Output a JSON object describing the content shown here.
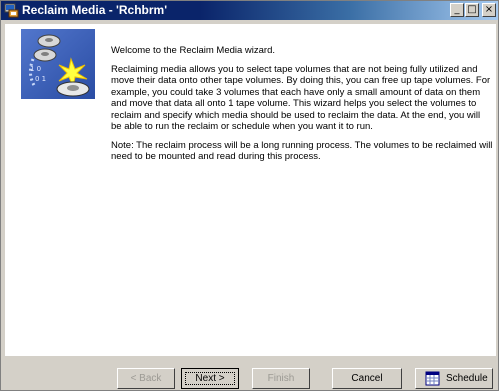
{
  "window": {
    "title": "Reclaim Media - 'Rchbrm'"
  },
  "title_buttons": {
    "minimize": "_",
    "maximize": "□",
    "close": "×"
  },
  "content": {
    "welcome": "Welcome to the Reclaim Media wizard.",
    "paragraph1": "Reclaiming media allows you to select  tape volumes that are not being fully utilized and move their data onto other tape volumes.  By doing this, you can free up tape volumes. For example, you could take 3 volumes that each have only a small amount of data on them and move that data all onto 1 tape volume.  This wizard helps you select the volumes to reclaim and specify which media should be used to reclaim the data.  At the end, you will be able to run the reclaim or schedule when you want it to run.",
    "note": "Note:  The reclaim process will be a long running process.  The volumes to be reclaimed will need to be mounted and read during this process."
  },
  "buttons": {
    "back": "< Back",
    "next": "Next >",
    "finish": "Finish",
    "cancel": "Cancel",
    "schedule": "Schedule"
  },
  "colors": {
    "title_bar": "#0a246a",
    "dialog_face": "#d4d0c8",
    "disabled_text": "#9c9a94"
  }
}
